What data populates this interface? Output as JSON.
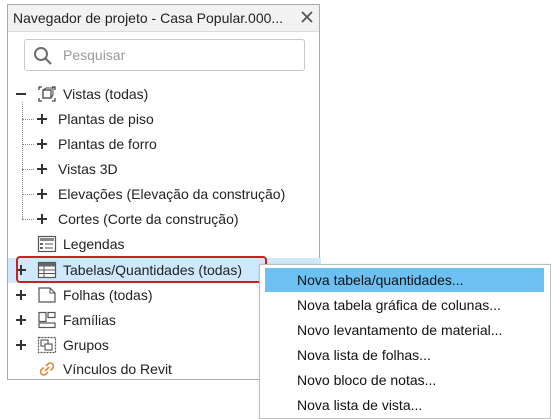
{
  "panel": {
    "title": "Navegador de projeto - Casa Popular.000...",
    "close_icon": "close-icon"
  },
  "search": {
    "placeholder": "Pesquisar",
    "icon": "search-icon"
  },
  "tree": {
    "views_all": "Vistas (todas)",
    "floor_plans": "Plantas de piso",
    "ceiling_plans": "Plantas de forro",
    "views_3d": "Vistas 3D",
    "elevations": "Elevações (Elevação da construção)",
    "sections": "Cortes (Corte da construção)",
    "legends": "Legendas",
    "schedules": "Tabelas/Quantidades (todas)",
    "sheets": "Folhas (todas)",
    "families": "Famílias",
    "groups": "Grupos",
    "revit_links": "Vínculos do Revit"
  },
  "context_menu": {
    "items": [
      "Nova tabela/quantidades...",
      "Nova tabela gráfica de colunas...",
      "Novo levantamento de material...",
      "Nova lista de folhas...",
      "Novo bloco de notas...",
      "Nova lista de vista..."
    ],
    "active_index": 0
  },
  "colors": {
    "selection_row": "#cfe8fb",
    "menu_highlight": "#6cc1f2",
    "callout_border": "#cc1f1f"
  }
}
